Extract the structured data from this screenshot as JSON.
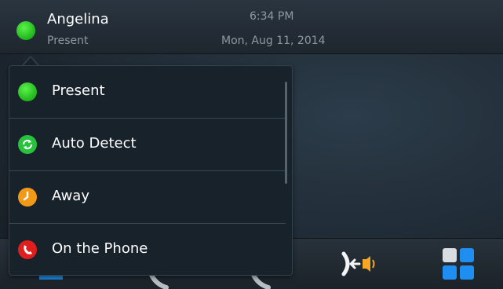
{
  "header": {
    "user_name": "Angelina",
    "presence_status": "Present",
    "time": "6:34 PM",
    "date": "Mon, Aug 11, 2014",
    "status_color": "#2ecc2a"
  },
  "presence_menu": {
    "items": [
      {
        "label": "Present",
        "icon": "present-dot-icon",
        "color": "#2ecc2a"
      },
      {
        "label": "Auto Detect",
        "icon": "refresh-icon",
        "color": "#28c23c"
      },
      {
        "label": "Away",
        "icon": "clock-icon",
        "color": "#f29a18"
      },
      {
        "label": "On the Phone",
        "icon": "phone-icon",
        "color": "#e01e1e"
      }
    ]
  },
  "bottom_bar": {
    "icons": [
      "contacts-icon",
      "recents-icon",
      "calls-icon",
      "call-transfer-icon",
      "apps-grid-icon"
    ],
    "accent_color": "#1e8ff0"
  }
}
